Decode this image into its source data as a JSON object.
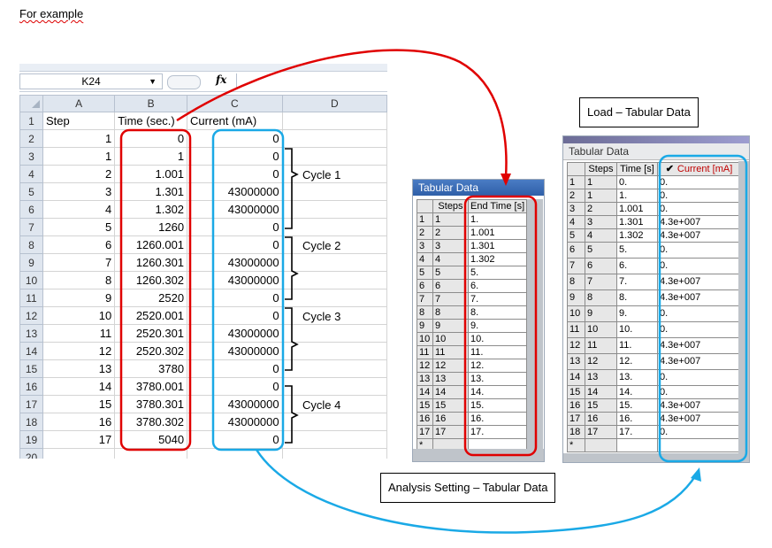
{
  "intro": "For example",
  "excel": {
    "namebox": "K24",
    "fx": "fx",
    "columns": [
      "A",
      "B",
      "C",
      "D"
    ],
    "rows": [
      {
        "n": "1",
        "a": "Step",
        "b": "Time (sec.)",
        "c": "Current (mA)",
        "hdr": true
      },
      {
        "n": "2",
        "a": "1",
        "b": "0",
        "c": "0"
      },
      {
        "n": "3",
        "a": "1",
        "b": "1",
        "c": "0"
      },
      {
        "n": "4",
        "a": "2",
        "b": "1.001",
        "c": "0"
      },
      {
        "n": "5",
        "a": "3",
        "b": "1.301",
        "c": "43000000"
      },
      {
        "n": "6",
        "a": "4",
        "b": "1.302",
        "c": "43000000"
      },
      {
        "n": "7",
        "a": "5",
        "b": "1260",
        "c": "0"
      },
      {
        "n": "8",
        "a": "6",
        "b": "1260.001",
        "c": "0"
      },
      {
        "n": "9",
        "a": "7",
        "b": "1260.301",
        "c": "43000000"
      },
      {
        "n": "10",
        "a": "8",
        "b": "1260.302",
        "c": "43000000"
      },
      {
        "n": "11",
        "a": "9",
        "b": "2520",
        "c": "0"
      },
      {
        "n": "12",
        "a": "10",
        "b": "2520.001",
        "c": "0"
      },
      {
        "n": "13",
        "a": "11",
        "b": "2520.301",
        "c": "43000000"
      },
      {
        "n": "14",
        "a": "12",
        "b": "2520.302",
        "c": "43000000"
      },
      {
        "n": "15",
        "a": "13",
        "b": "3780",
        "c": "0"
      },
      {
        "n": "16",
        "a": "14",
        "b": "3780.001",
        "c": "0"
      },
      {
        "n": "17",
        "a": "15",
        "b": "3780.301",
        "c": "43000000"
      },
      {
        "n": "18",
        "a": "16",
        "b": "3780.302",
        "c": "43000000"
      },
      {
        "n": "19",
        "a": "17",
        "b": "5040",
        "c": "0"
      },
      {
        "n": "20",
        "a": "",
        "b": "",
        "c": ""
      }
    ],
    "cycles": [
      "Cycle 1",
      "Cycle 2",
      "Cycle 3",
      "Cycle 4"
    ]
  },
  "analysis": {
    "title": "Tabular Data",
    "headers": [
      "Steps",
      "End Time [s]"
    ],
    "rows": [
      [
        "1",
        "1",
        "1."
      ],
      [
        "2",
        "2",
        "1.001"
      ],
      [
        "3",
        "3",
        "1.301"
      ],
      [
        "4",
        "4",
        "1.302"
      ],
      [
        "5",
        "5",
        "5."
      ],
      [
        "6",
        "6",
        "6."
      ],
      [
        "7",
        "7",
        "7."
      ],
      [
        "8",
        "8",
        "8."
      ],
      [
        "9",
        "9",
        "9."
      ],
      [
        "10",
        "10",
        "10."
      ],
      [
        "11",
        "11",
        "11."
      ],
      [
        "12",
        "12",
        "12."
      ],
      [
        "13",
        "13",
        "13."
      ],
      [
        "14",
        "14",
        "14."
      ],
      [
        "15",
        "15",
        "15."
      ],
      [
        "16",
        "16",
        "16."
      ],
      [
        "17",
        "17",
        "17."
      ],
      [
        "*",
        "",
        ""
      ]
    ]
  },
  "load": {
    "title": "Tabular Data",
    "headers": [
      "Steps",
      "Time [s]",
      "Current [mA]"
    ],
    "check_mark": "✔",
    "rows": [
      [
        "1",
        "1",
        "0.",
        "0."
      ],
      [
        "2",
        "1",
        "1.",
        "0."
      ],
      [
        "3",
        "2",
        "1.001",
        "0."
      ],
      [
        "4",
        "3",
        "1.301",
        "4.3e+007"
      ],
      [
        "5",
        "4",
        "1.302",
        "4.3e+007"
      ],
      [
        "6",
        "5",
        "5.",
        "0."
      ],
      [
        "7",
        "6",
        "6.",
        "0."
      ],
      [
        "8",
        "7",
        "7.",
        "4.3e+007"
      ],
      [
        "9",
        "8",
        "8.",
        "4.3e+007"
      ],
      [
        "10",
        "9",
        "9.",
        "0."
      ],
      [
        "11",
        "10",
        "10.",
        "0."
      ],
      [
        "12",
        "11",
        "11.",
        "4.3e+007"
      ],
      [
        "13",
        "12",
        "12.",
        "4.3e+007"
      ],
      [
        "14",
        "13",
        "13.",
        "0."
      ],
      [
        "15",
        "14",
        "14.",
        "0."
      ],
      [
        "16",
        "15",
        "15.",
        "4.3e+007"
      ],
      [
        "17",
        "16",
        "16.",
        "4.3e+007"
      ],
      [
        "18",
        "17",
        "17.",
        "0."
      ],
      [
        "*",
        "",
        "",
        ""
      ]
    ]
  },
  "labels": {
    "load": "Load – Tabular Data",
    "analysis": "Analysis Setting – Tabular Data"
  },
  "colors": {
    "red": "#e00000",
    "blue": "#1aa9e6",
    "current_header": "#c00000"
  }
}
